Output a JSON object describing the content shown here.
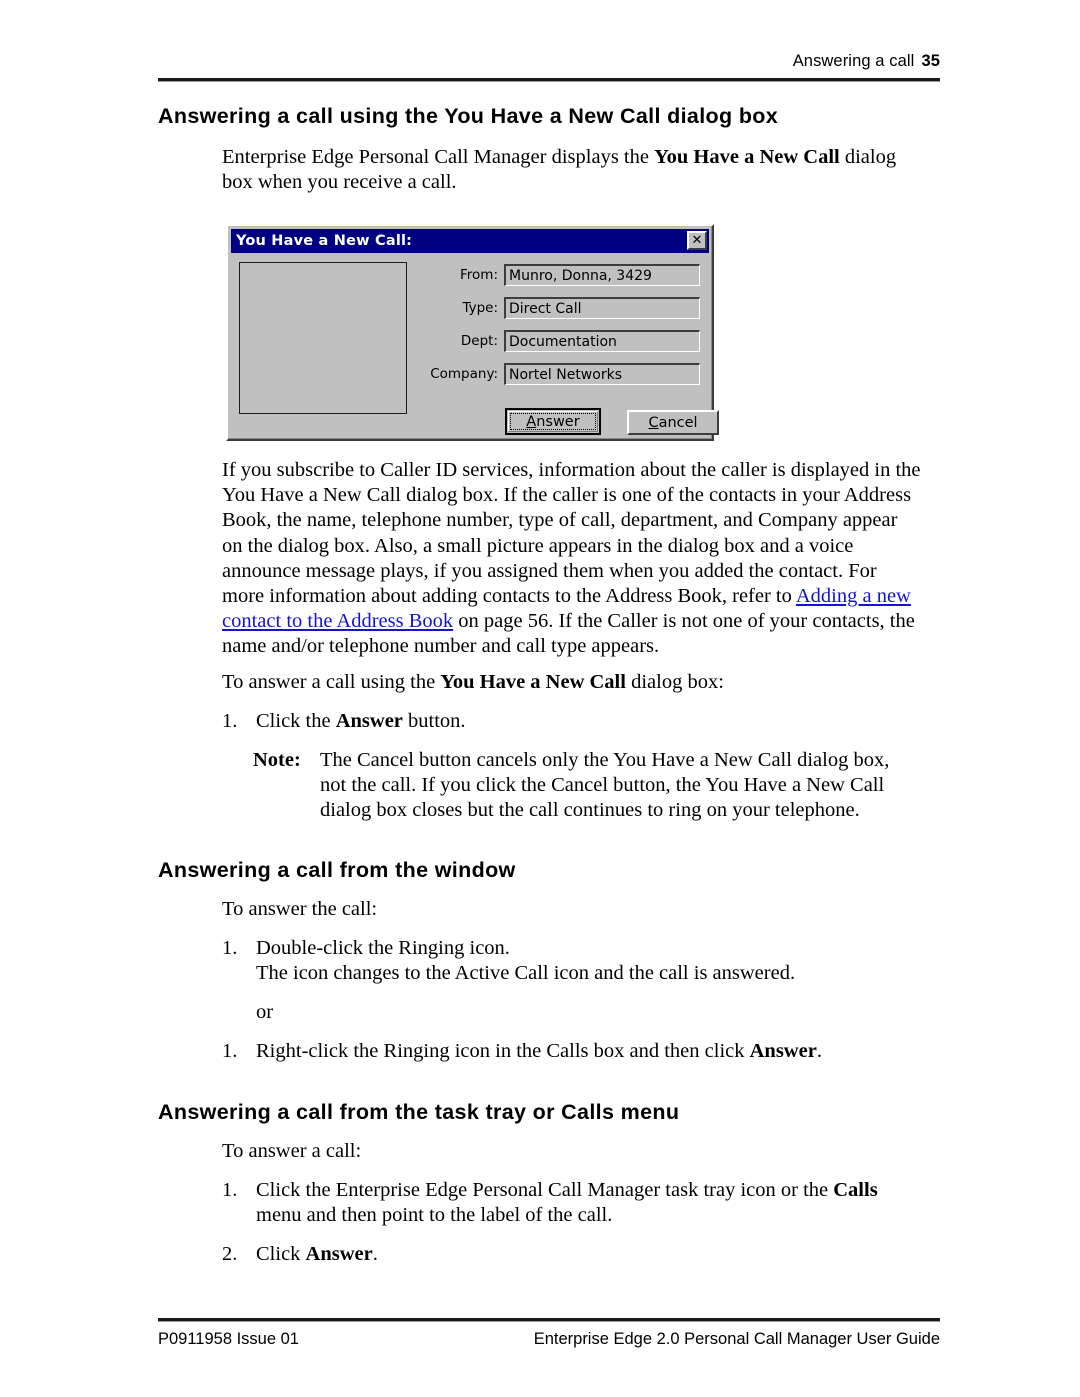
{
  "header": {
    "running_head": "Answering a call",
    "page_number": "35"
  },
  "sections": {
    "heading1": "Answering a call using the You Have a New Call dialog box",
    "intro_before": "Enterprise Edge Personal Call Manager displays the ",
    "intro_bold": "You Have a New Call",
    "intro_after": " dialog box when you receive a call.",
    "caller_id_p1": "If you subscribe to Caller ID services, information about the caller is displayed in the You Have a New Call dialog box. If the caller is one of the contacts in your Address Book, the name, telephone number, type of call, department, and Company appear on the dialog box. Also, a small picture appears in the dialog box and a voice announce message plays, if you assigned them when you added the contact. For more information about adding contacts to the Address Book, refer to ",
    "caller_id_link": "Adding a new contact to the Address Book",
    "caller_id_p2": " on page 56. If the Caller is not one of your contacts, the name and/or telephone number and call type appears.",
    "to_answer_before": "To answer a call using the ",
    "to_answer_bold": "You Have a New Call",
    "to_answer_after": " dialog box:",
    "step1_num": "1.",
    "step1_before": "Click the ",
    "step1_bold": "Answer",
    "step1_after": " button.",
    "note_label": "Note:",
    "note_text": "The Cancel button cancels only the You Have a New Call dialog box, not the call. If you click the Cancel button, the You Have a New Call dialog box closes but the call continues to ring on your telephone.",
    "heading2": "Answering a call from the window",
    "to_answer_call": "To answer the call:",
    "win_step1_num": "1.",
    "win_step1_line1": "Double-click the Ringing icon.",
    "win_step1_line2": "The icon changes to the Active Call icon and the call is answered.",
    "or_text": "or",
    "win_step2_num": "1.",
    "win_step2_before": "Right-click the Ringing icon in the Calls box and then click ",
    "win_step2_bold": "Answer",
    "win_step2_after": ".",
    "heading3": "Answering a call from the task tray or Calls menu",
    "tray_intro": "To answer a call:",
    "tray_step1_num": "1.",
    "tray_step1_before": "Click the Enterprise Edge Personal Call Manager task tray icon or the ",
    "tray_step1_bold": "Calls",
    "tray_step1_after": " menu and then point to the label of the call.",
    "tray_step2_num": "2.",
    "tray_step2_before": "Click ",
    "tray_step2_bold": "Answer",
    "tray_step2_after": "."
  },
  "dialog": {
    "title": "You Have a New Call:",
    "close_icon_label": "✕",
    "fields": [
      {
        "label": "From:",
        "value": "Munro, Donna, 3429"
      },
      {
        "label": "Type:",
        "value": "Direct Call"
      },
      {
        "label": "Dept:",
        "value": "Documentation"
      },
      {
        "label": "Company:",
        "value": "Nortel Networks"
      }
    ],
    "buttons": {
      "answer_accel": "A",
      "answer_rest": "nswer",
      "cancel_accel": "C",
      "cancel_rest": "ancel"
    },
    "colors": {
      "titlebar": "#000080",
      "face": "#c0c0c0",
      "title_text": "#ffffff"
    }
  },
  "footer": {
    "left": "P0911958 Issue 01",
    "right": "Enterprise Edge 2.0 Personal Call Manager User Guide"
  }
}
